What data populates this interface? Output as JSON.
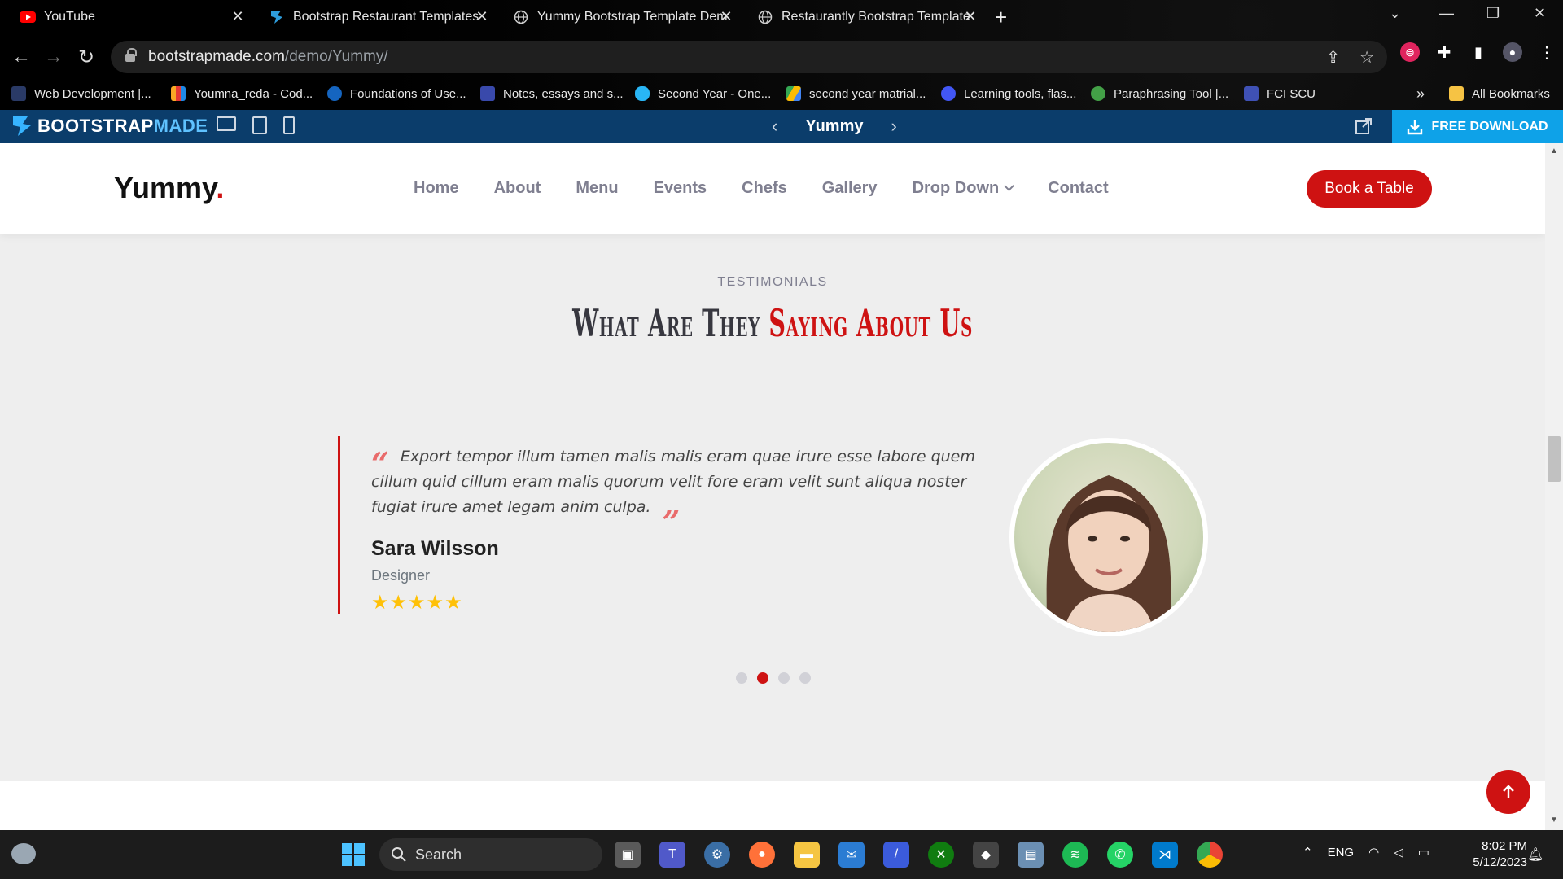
{
  "browser": {
    "tabs": [
      {
        "title": "YouTube"
      },
      {
        "title": "Bootstrap Restaurant Templates"
      },
      {
        "title": "Yummy Bootstrap Template Dem"
      },
      {
        "title": "Restaurantly Bootstrap Template"
      }
    ],
    "url_host": "bootstrapmade.com",
    "url_path": "/demo/Yummy/",
    "bookmarks": [
      {
        "label": "Web Development |..."
      },
      {
        "label": "Youmna_reda - Cod..."
      },
      {
        "label": "Foundations of Use..."
      },
      {
        "label": "Notes, essays and s..."
      },
      {
        "label": "Second Year - One..."
      },
      {
        "label": "second year matrial..."
      },
      {
        "label": "Learning tools, flas..."
      },
      {
        "label": "Paraphrasing Tool |..."
      },
      {
        "label": "FCI SCU"
      }
    ],
    "bookmarks_more": "»",
    "all_bookmarks": "All Bookmarks"
  },
  "demo_bar": {
    "logo_bootstrap": "BOOTSTRAP",
    "logo_made": "MADE",
    "template_name": "Yummy",
    "download_label": "FREE DOWNLOAD"
  },
  "site": {
    "brand": "Yummy",
    "brand_dot": ".",
    "nav": [
      "Home",
      "About",
      "Menu",
      "Events",
      "Chefs",
      "Gallery",
      "Drop Down",
      "Contact"
    ],
    "cta": "Book a Table",
    "accent_color": "#ce1212"
  },
  "testimonials": {
    "kicker": "TESTIMONIALS",
    "title_start": "What Are They ",
    "title_accent": "Saying About Us",
    "quote": "Export tempor illum tamen malis malis eram quae irure esse labore quem cillum quid cillum eram malis quorum velit fore eram velit sunt aliqua noster fugiat irure amet legam anim culpa.",
    "name": "Sara Wilsson",
    "role": "Designer",
    "stars": "★★★★★",
    "rating": 5,
    "slide_count": 4,
    "active_slide": 2
  },
  "taskbar": {
    "search_label": "Search",
    "language": "ENG",
    "time": "8:02 PM",
    "date": "5/12/2023"
  }
}
